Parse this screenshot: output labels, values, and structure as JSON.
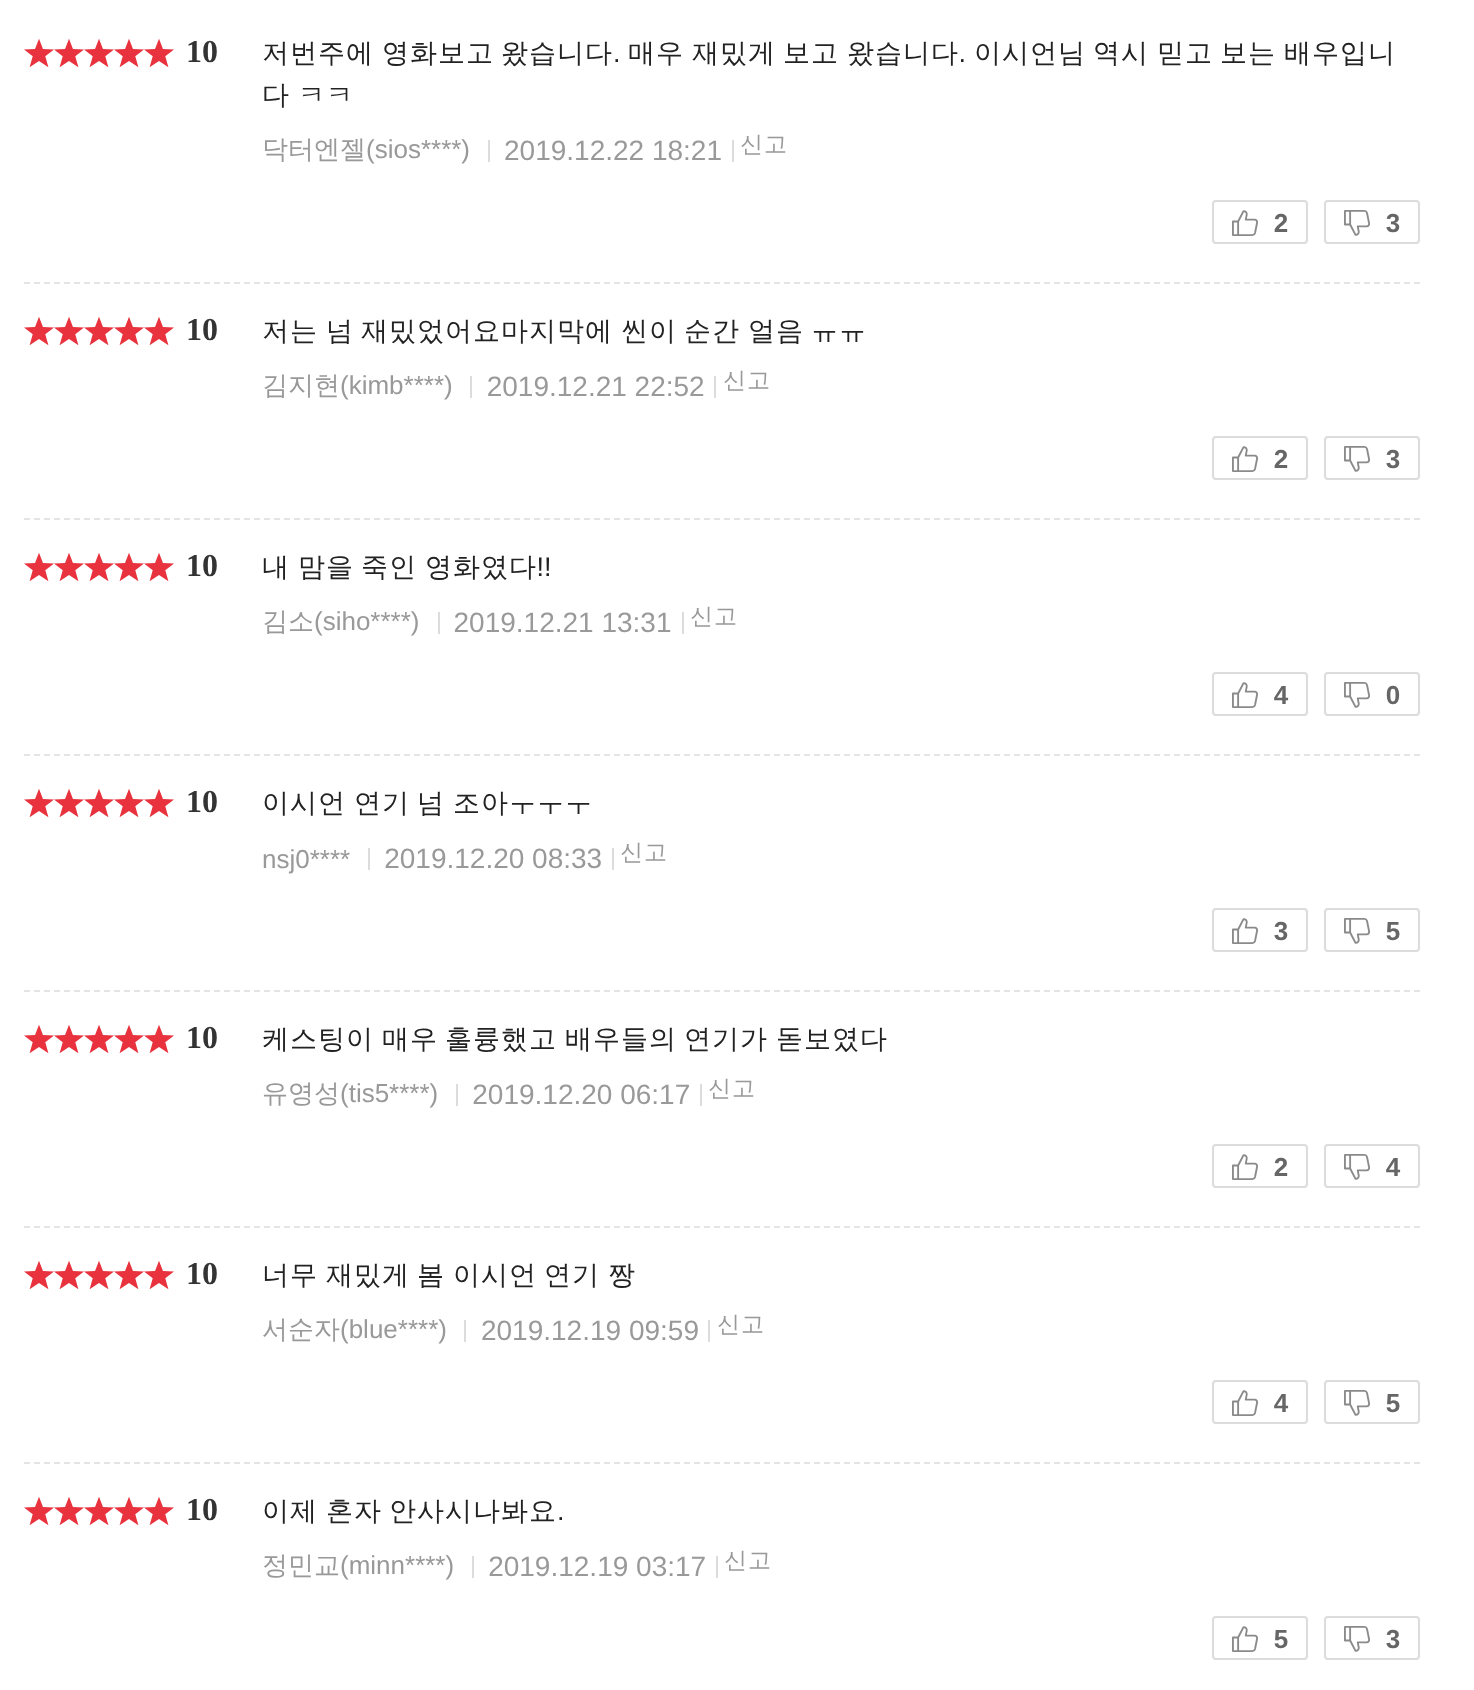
{
  "reviews": [
    {
      "stars": 5,
      "score": "10",
      "text": "저번주에 영화보고 왔습니다. 매우 재밌게 보고 왔습니다. 이시언님 역시 믿고 보는 배우입니다 ㅋㅋ",
      "author": "닥터엔젤(sios****)",
      "date": "2019.12.22 18:21",
      "report": "신고",
      "likes": "2",
      "dislikes": "3"
    },
    {
      "stars": 5,
      "score": "10",
      "text": "저는 넘 재밌었어요마지막에 씬이 순간 얼음 ㅠㅠ",
      "author": "김지현(kimb****)",
      "date": "2019.12.21 22:52",
      "report": "신고",
      "likes": "2",
      "dislikes": "3"
    },
    {
      "stars": 5,
      "score": "10",
      "text": "내 맘을 죽인 영화였다!!",
      "author": "김소(siho****)",
      "date": "2019.12.21 13:31",
      "report": "신고",
      "likes": "4",
      "dislikes": "0"
    },
    {
      "stars": 5,
      "score": "10",
      "text": "이시언 연기 넘 조아ㅜㅜㅜ",
      "author": "nsj0****",
      "date": "2019.12.20 08:33",
      "report": "신고",
      "likes": "3",
      "dislikes": "5"
    },
    {
      "stars": 5,
      "score": "10",
      "text": "케스팅이 매우 훌륭했고 배우들의 연기가 돋보였다",
      "author": "유영성(tis5****)",
      "date": "2019.12.20 06:17",
      "report": "신고",
      "likes": "2",
      "dislikes": "4"
    },
    {
      "stars": 5,
      "score": "10",
      "text": "너무 재밌게 봄 이시언 연기 짱",
      "author": "서순자(blue****)",
      "date": "2019.12.19 09:59",
      "report": "신고",
      "likes": "4",
      "dislikes": "5"
    },
    {
      "stars": 5,
      "score": "10",
      "text": "이제 혼자 안사시나봐요.",
      "author": "정민교(minn****)",
      "date": "2019.12.19 03:17",
      "report": "신고",
      "likes": "5",
      "dislikes": "3"
    }
  ]
}
